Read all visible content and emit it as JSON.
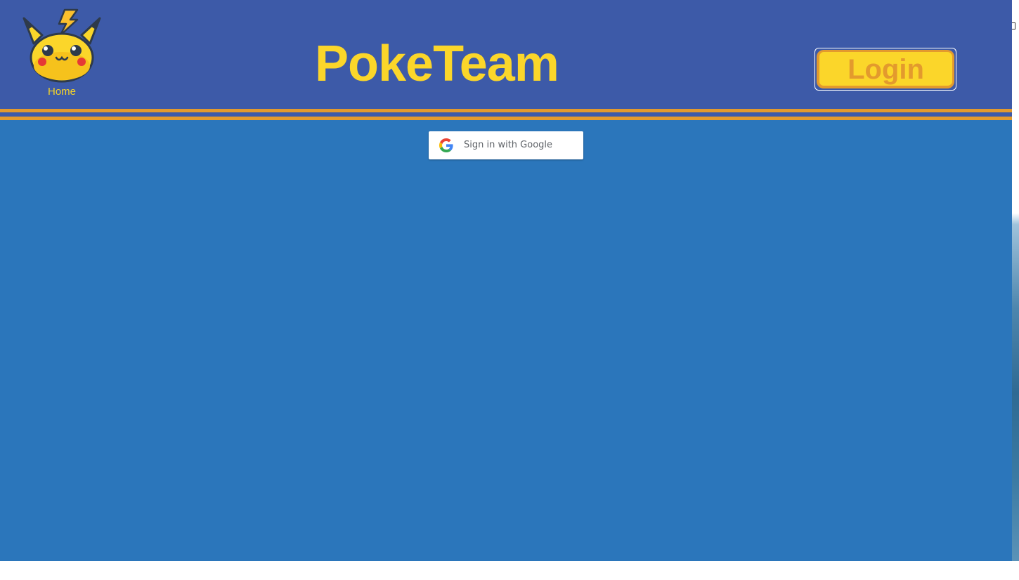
{
  "header": {
    "home_label": "Home",
    "title": "PokeTeam",
    "login_label": "Login",
    "logo_icon": "pikachu-logo-icon"
  },
  "main": {
    "google_signin_label": "Sign in with Google",
    "google_icon": "google-g-icon"
  },
  "colors": {
    "header_bg": "#3d5aa8",
    "page_bg": "#2b76bb",
    "accent_yellow": "#fbd62a",
    "accent_orange": "#e39a2d"
  }
}
